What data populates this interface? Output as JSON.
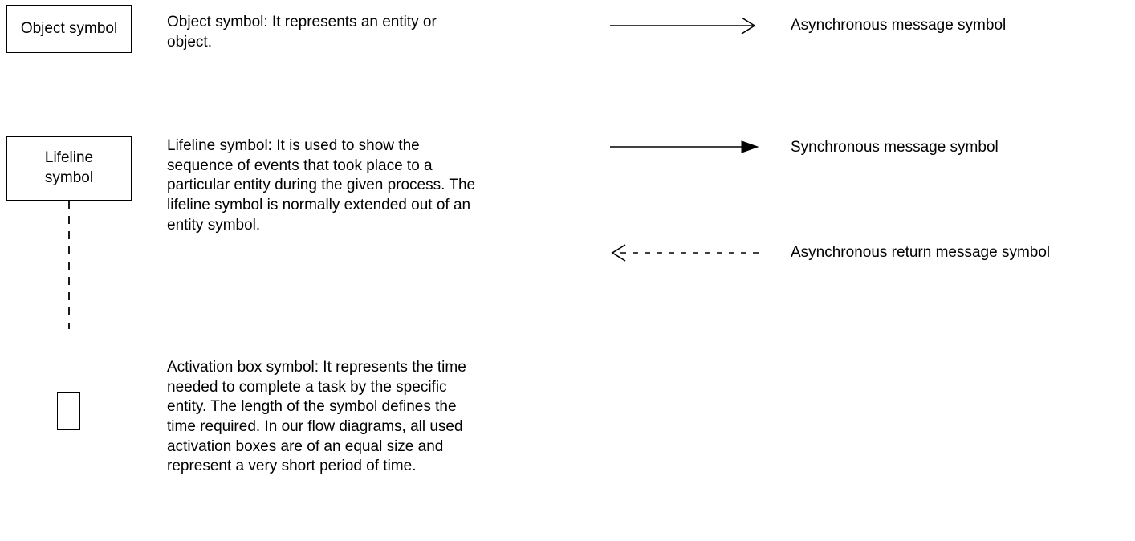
{
  "left": {
    "objectSymbol": {
      "boxLabel": "Object symbol",
      "desc": "Object symbol: It represents an entity or object."
    },
    "lifelineSymbol": {
      "boxLabel": "Lifeline\nsymbol",
      "desc": "Lifeline symbol: It is used to show the sequence of events that took place to a particular entity during the given process. The lifeline symbol is normally extended out of an entity symbol."
    },
    "activationBox": {
      "desc": "Activation box symbol: It represents the time needed to complete a task by the specific entity. The length of the symbol defines the time required. In our flow diagrams, all used activation boxes are of an equal size and represent a very short period of time."
    }
  },
  "right": {
    "asyncMsg": "Asynchronous message symbol",
    "syncMsg": "Synchronous message symbol",
    "asyncReturnMsg": "Asynchronous return message symbol"
  }
}
